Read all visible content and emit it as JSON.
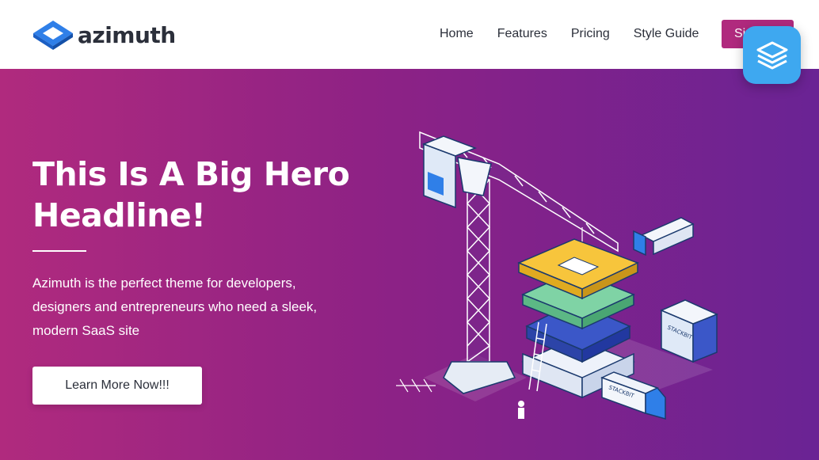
{
  "brand": {
    "name": "azimuth"
  },
  "nav": {
    "items": [
      {
        "label": "Home"
      },
      {
        "label": "Features"
      },
      {
        "label": "Pricing"
      },
      {
        "label": "Style Guide"
      }
    ],
    "cta_label": "Sign Up"
  },
  "hero": {
    "headline": "This Is A Big Hero Headline!",
    "subtext": "Azimuth is the perfect theme for developers, designers and entrepreneurs who need a sleek, modern SaaS site",
    "button_label": "Learn More Now!!!",
    "illustration": {
      "container_label_1": "STACKBIT",
      "container_label_2": "STACKBIT"
    }
  },
  "colors": {
    "brand_blue": "#2f7fe8",
    "hero_gradient_start": "#b02a7e",
    "hero_gradient_end": "#6a2394",
    "cta": "#b02a7e",
    "badge": "#3ea8f0"
  }
}
